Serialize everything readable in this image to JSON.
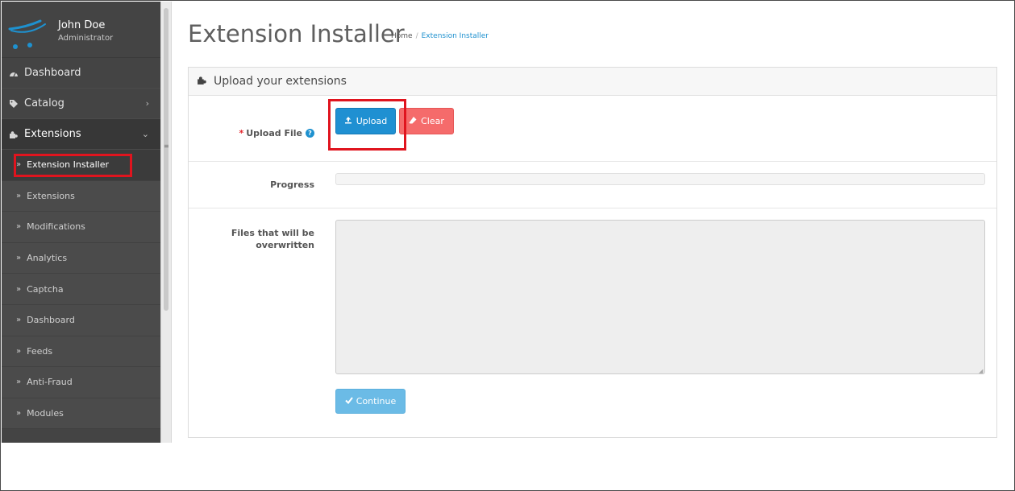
{
  "user": {
    "name": "John Doe",
    "role": "Administrator"
  },
  "nav": {
    "dashboard": "Dashboard",
    "catalog": "Catalog",
    "extensions": "Extensions",
    "sub_items": [
      "Extension Installer",
      "Extensions",
      "Modifications",
      "Analytics",
      "Captcha",
      "Dashboard",
      "Feeds",
      "Anti-Fraud",
      "Modules"
    ]
  },
  "header": {
    "title": "Extension Installer",
    "breadcrumb": {
      "home": "Home",
      "separator": "/",
      "current": "Extension Installer"
    }
  },
  "panel": {
    "heading": "Upload your extensions",
    "upload_file": {
      "required_mark": "*",
      "label": "Upload File",
      "help": "?"
    },
    "buttons": {
      "upload": "Upload",
      "clear": "Clear",
      "continue": "Continue"
    },
    "progress": {
      "label": "Progress",
      "value": 0
    },
    "overwritten": {
      "label_line1": "Files that will be",
      "label_line2": "overwritten",
      "value": ""
    }
  },
  "colors": {
    "sidebar_bg": "#444444",
    "primary": "#1f90d2",
    "danger": "#f56b6b",
    "info_disabled": "#6bbbe6",
    "highlight": "#e0141e"
  },
  "icons": {
    "logo": "cart-logo-icon",
    "dashboard": "dashboard-icon",
    "catalog": "tag-icon",
    "extensions": "puzzle-icon",
    "sub_item": "double-chevron-right-icon",
    "help": "question-circle-icon",
    "upload": "upload-icon",
    "clear": "eraser-icon",
    "continue": "check-icon"
  }
}
